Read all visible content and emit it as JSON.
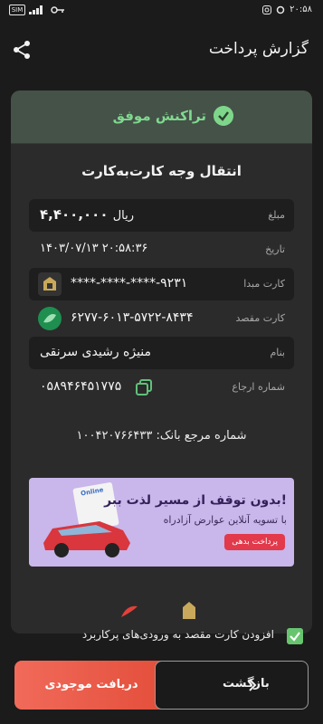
{
  "status_bar": {
    "time": "۲۰:۵۸",
    "left_icons": [
      "sim-icon",
      "signal-icon",
      "key-icon"
    ],
    "sim_text": "SIM"
  },
  "header": {
    "title": "گزارش پرداخت",
    "share_icon": "share-icon"
  },
  "result": {
    "status_text": "تراکنش موفق",
    "status_icon": "check-circle-icon",
    "status_color": "#7fd98f"
  },
  "transaction": {
    "title": "انتقال وجه کارت‌به‌کارت",
    "amount_label": "مبلغ",
    "amount_value": "۴,۴۰۰,۰۰۰",
    "amount_unit": "ریال",
    "date_label": "تاریخ",
    "date_value": "۱۴۰۳/۰۷/۱۳ ۲۰:۵۸:۳۶",
    "source_label": "کارت مبدا",
    "source_value": "****-****-****-۹۲۳۱",
    "dest_label": "کارت مقصد",
    "dest_value": "۶۲۷۷-۶۰۱۳-۵۷۲۲-۸۴۳۴",
    "name_label": "بنام",
    "name_value": "منیژه رشیدی سرنقی",
    "ref_label": "شماره ارجاع",
    "ref_value": "۰۵۸۹۴۶۴۵۱۷۷۵",
    "bank_ref_text": "شماره مرجع بانک: ۱۰۰۴۲۰۷۶۶۴۳۳"
  },
  "banner": {
    "headline": "بدون توقف از مسیر لذت ببر!",
    "sub": "با تسویه آنلاین عوارض آزادراه",
    "cta": "پرداخت بدهی",
    "doc_text": "Online"
  },
  "footer": {
    "checkbox_label": "افزودن کارت مقصد به ورودی‌های پرکاربرد",
    "checkbox_checked": true,
    "receive_button": "دریافت موجودی",
    "back_button": "بازگشت"
  }
}
